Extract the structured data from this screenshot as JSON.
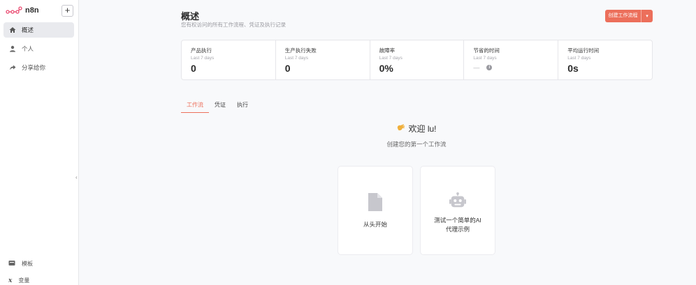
{
  "app": {
    "name": "n8n",
    "add_label": "+"
  },
  "sidebar": {
    "items": [
      {
        "label": "概述",
        "icon": "home-icon",
        "active": true
      },
      {
        "label": "个人",
        "icon": "user-icon",
        "active": false
      },
      {
        "label": "分享给你",
        "icon": "share-icon",
        "active": false
      }
    ],
    "bottom": [
      {
        "label": "模板",
        "icon": "template-icon"
      },
      {
        "label": "变量",
        "icon": "variable-icon"
      }
    ]
  },
  "header": {
    "title": "概述",
    "subtitle": "您有权访问的所有工作流程、凭证及执行记录",
    "create_button": "创建工作流程"
  },
  "stats": [
    {
      "title": "产品执行",
      "sub": "Last 7 days",
      "value": "0"
    },
    {
      "title": "生产执行失败",
      "sub": "Last 7 days",
      "value": "0"
    },
    {
      "title": "故障率",
      "sub": "Last 7 days",
      "value": "0%"
    },
    {
      "title": "节省的时间",
      "sub": "Last 7 days",
      "value": "—"
    },
    {
      "title": "平均运行时间",
      "sub": "Last 7 days",
      "value": "0s"
    }
  ],
  "tabs": [
    {
      "label": "工作流",
      "active": true
    },
    {
      "label": "凭证",
      "active": false
    },
    {
      "label": "执行",
      "active": false
    }
  ],
  "welcome": {
    "title": "欢迎 lu!",
    "subtitle": "创建您的第一个工作流"
  },
  "cards": {
    "scratch": "从头开始",
    "ai_line1": "测试一个简单的AI",
    "ai_line2": "代理示例"
  },
  "colors": {
    "accent": "#ec6f5b",
    "sidebar_active": "#e9eaee"
  }
}
